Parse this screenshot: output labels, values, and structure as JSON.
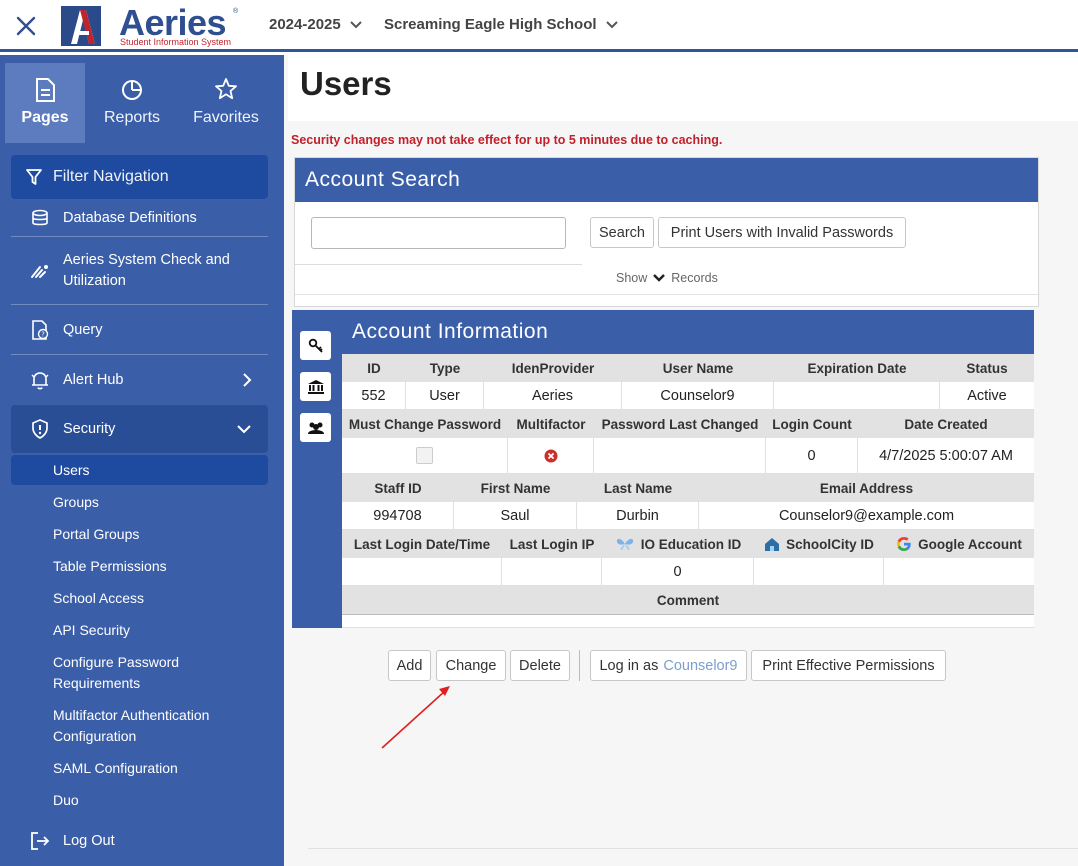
{
  "header": {
    "logo_word": "Aeries",
    "logo_tagline": "Student Information System",
    "logo_reg": "®",
    "year": "2024-2025",
    "school": "Screaming Eagle High School"
  },
  "sidebar": {
    "tabs": [
      {
        "label": "Pages",
        "icon": "page-icon"
      },
      {
        "label": "Reports",
        "icon": "pie-chart-icon"
      },
      {
        "label": "Favorites",
        "icon": "star-icon"
      }
    ],
    "filter_label": "Filter Navigation",
    "items": [
      {
        "label": "Database Definitions",
        "icon": "database-icon"
      },
      {
        "label": "Aeries System Check and Utilization",
        "icon": "signal-icon"
      },
      {
        "label": "Query",
        "icon": "query-icon"
      },
      {
        "label": "Alert Hub",
        "icon": "bell-icon"
      },
      {
        "label": "Security",
        "icon": "shield-icon"
      },
      {
        "label": "Log Out",
        "icon": "logout-icon"
      }
    ],
    "security_sub": [
      {
        "label": "Users"
      },
      {
        "label": "Groups"
      },
      {
        "label": "Portal Groups"
      },
      {
        "label": "Table Permissions"
      },
      {
        "label": "School Access"
      },
      {
        "label": "API Security"
      },
      {
        "label": "Configure Password Requirements"
      },
      {
        "label": "Multifactor Authentication Configuration"
      },
      {
        "label": "SAML Configuration"
      },
      {
        "label": "Duo"
      }
    ]
  },
  "main": {
    "title": "Users",
    "warning": "Security changes may not take effect for up to 5 minutes due to caching.",
    "search": {
      "title": "Account Search",
      "value": "",
      "search_btn": "Search",
      "print_invalid_btn": "Print Users with Invalid Passwords",
      "show_label": "Show",
      "records_label": "Records"
    },
    "account": {
      "title": "Account Information",
      "row1_headers": [
        "ID",
        "Type",
        "IdenProvider",
        "User Name",
        "Expiration Date",
        "Status"
      ],
      "row1_values": [
        "552",
        "User",
        "Aeries",
        "Counselor9",
        "",
        "Active"
      ],
      "row2_headers": [
        "Must Change Password",
        "Multifactor",
        "Password Last Changed",
        "Login Count",
        "Date Created"
      ],
      "row2_values": {
        "must_change": "",
        "multifactor": "",
        "pw_changed": "",
        "login_count": "0",
        "date_created": "4/7/2025 5:00:07 AM"
      },
      "row3_headers": [
        "Staff ID",
        "First Name",
        "Last Name",
        "Email Address"
      ],
      "row3_values": [
        "994708",
        "Saul",
        "Durbin",
        "Counselor9@example.com"
      ],
      "row4_headers": [
        "Last Login Date/Time",
        "Last Login IP",
        "IO Education ID",
        "SchoolCity ID",
        "Google Account"
      ],
      "row4_values": [
        "",
        "",
        "0",
        "",
        ""
      ],
      "comment_header": "Comment"
    },
    "actions": {
      "add": "Add",
      "change": "Change",
      "delete": "Delete",
      "login_as_prefix": "Log in as",
      "login_as_user": "Counselor9",
      "print_perms": "Print Effective Permissions"
    }
  },
  "colors": {
    "brand_blue": "#3b5ea8",
    "dark_blue": "#1e4ba0",
    "warning_red": "#c2202a",
    "annotation_arrow": "#e02020"
  }
}
